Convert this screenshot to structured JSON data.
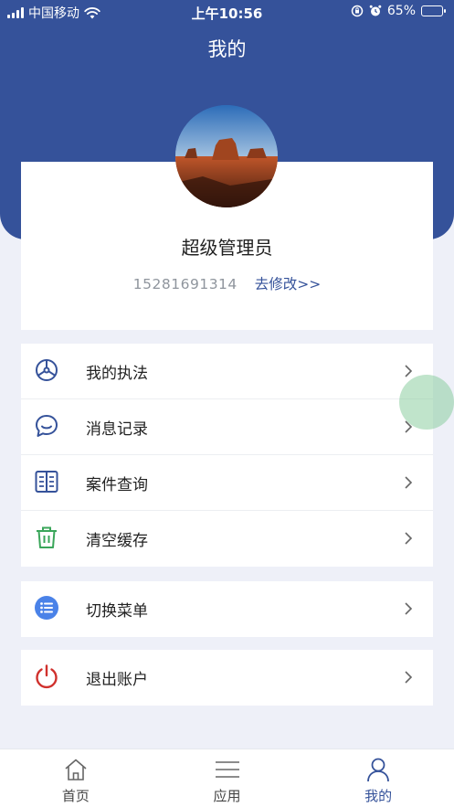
{
  "status_bar": {
    "carrier": "中国移动",
    "time": "上午10:56",
    "battery": "65%",
    "battery_level": 0.65
  },
  "header": {
    "title": "我的"
  },
  "profile": {
    "name": "超级管理员",
    "phone": "15281691314",
    "edit_link": "去修改>>"
  },
  "menu": {
    "group1": [
      {
        "label": "我的执法",
        "icon": "steering-wheel-icon"
      },
      {
        "label": "消息记录",
        "icon": "chat-bubble-icon"
      },
      {
        "label": "案件查询",
        "icon": "book-icon"
      },
      {
        "label": "清空缓存",
        "icon": "trash-icon"
      }
    ],
    "group2": [
      {
        "label": "切换菜单",
        "icon": "list-icon"
      }
    ],
    "group3": [
      {
        "label": "退出账户",
        "icon": "power-icon"
      }
    ]
  },
  "tabs": [
    {
      "label": "首页",
      "icon": "home-icon",
      "active": false
    },
    {
      "label": "应用",
      "icon": "menu-icon",
      "active": false
    },
    {
      "label": "我的",
      "icon": "user-icon",
      "active": true
    }
  ],
  "colors": {
    "primary": "#35529a",
    "background": "#eef0f8",
    "trash": "#3aa65a",
    "list_icon": "#4a82e8",
    "power": "#d0312d",
    "float_circle": "#8ccda0"
  }
}
